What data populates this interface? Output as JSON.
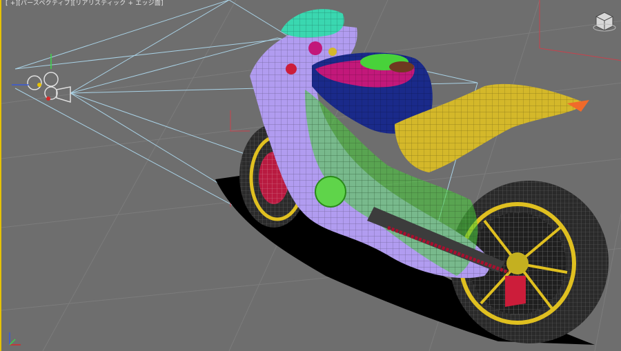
{
  "viewport": {
    "label": "[ +][パースペクティブ][リアリスティック + エッジ面]",
    "view": "perspective",
    "display_mode": "wireframe",
    "border_color": "#e6c200",
    "background_color": "#6e6e6e"
  },
  "scene": {
    "object": "motorcycle-wireframe-model",
    "gizmo": "camera-light-gizmo"
  },
  "colors": {
    "grid": "#7a7a7a",
    "frame_violet": "#b19cf0",
    "tank_blue": "#1a2a8a",
    "tank_magenta": "#c2187a",
    "seat_yellow": "#d4b82a",
    "tire_dark": "#2e2e2e",
    "rim_yellow": "#e0c020",
    "chassis_green": "#48d23a",
    "canopy_cyan": "#3ad7b0",
    "brake_red": "#cc1d3a",
    "chain_red": "#a8102e"
  },
  "icons": {
    "viewcube": "viewcube-icon",
    "axis": "axis-tripod-icon"
  }
}
